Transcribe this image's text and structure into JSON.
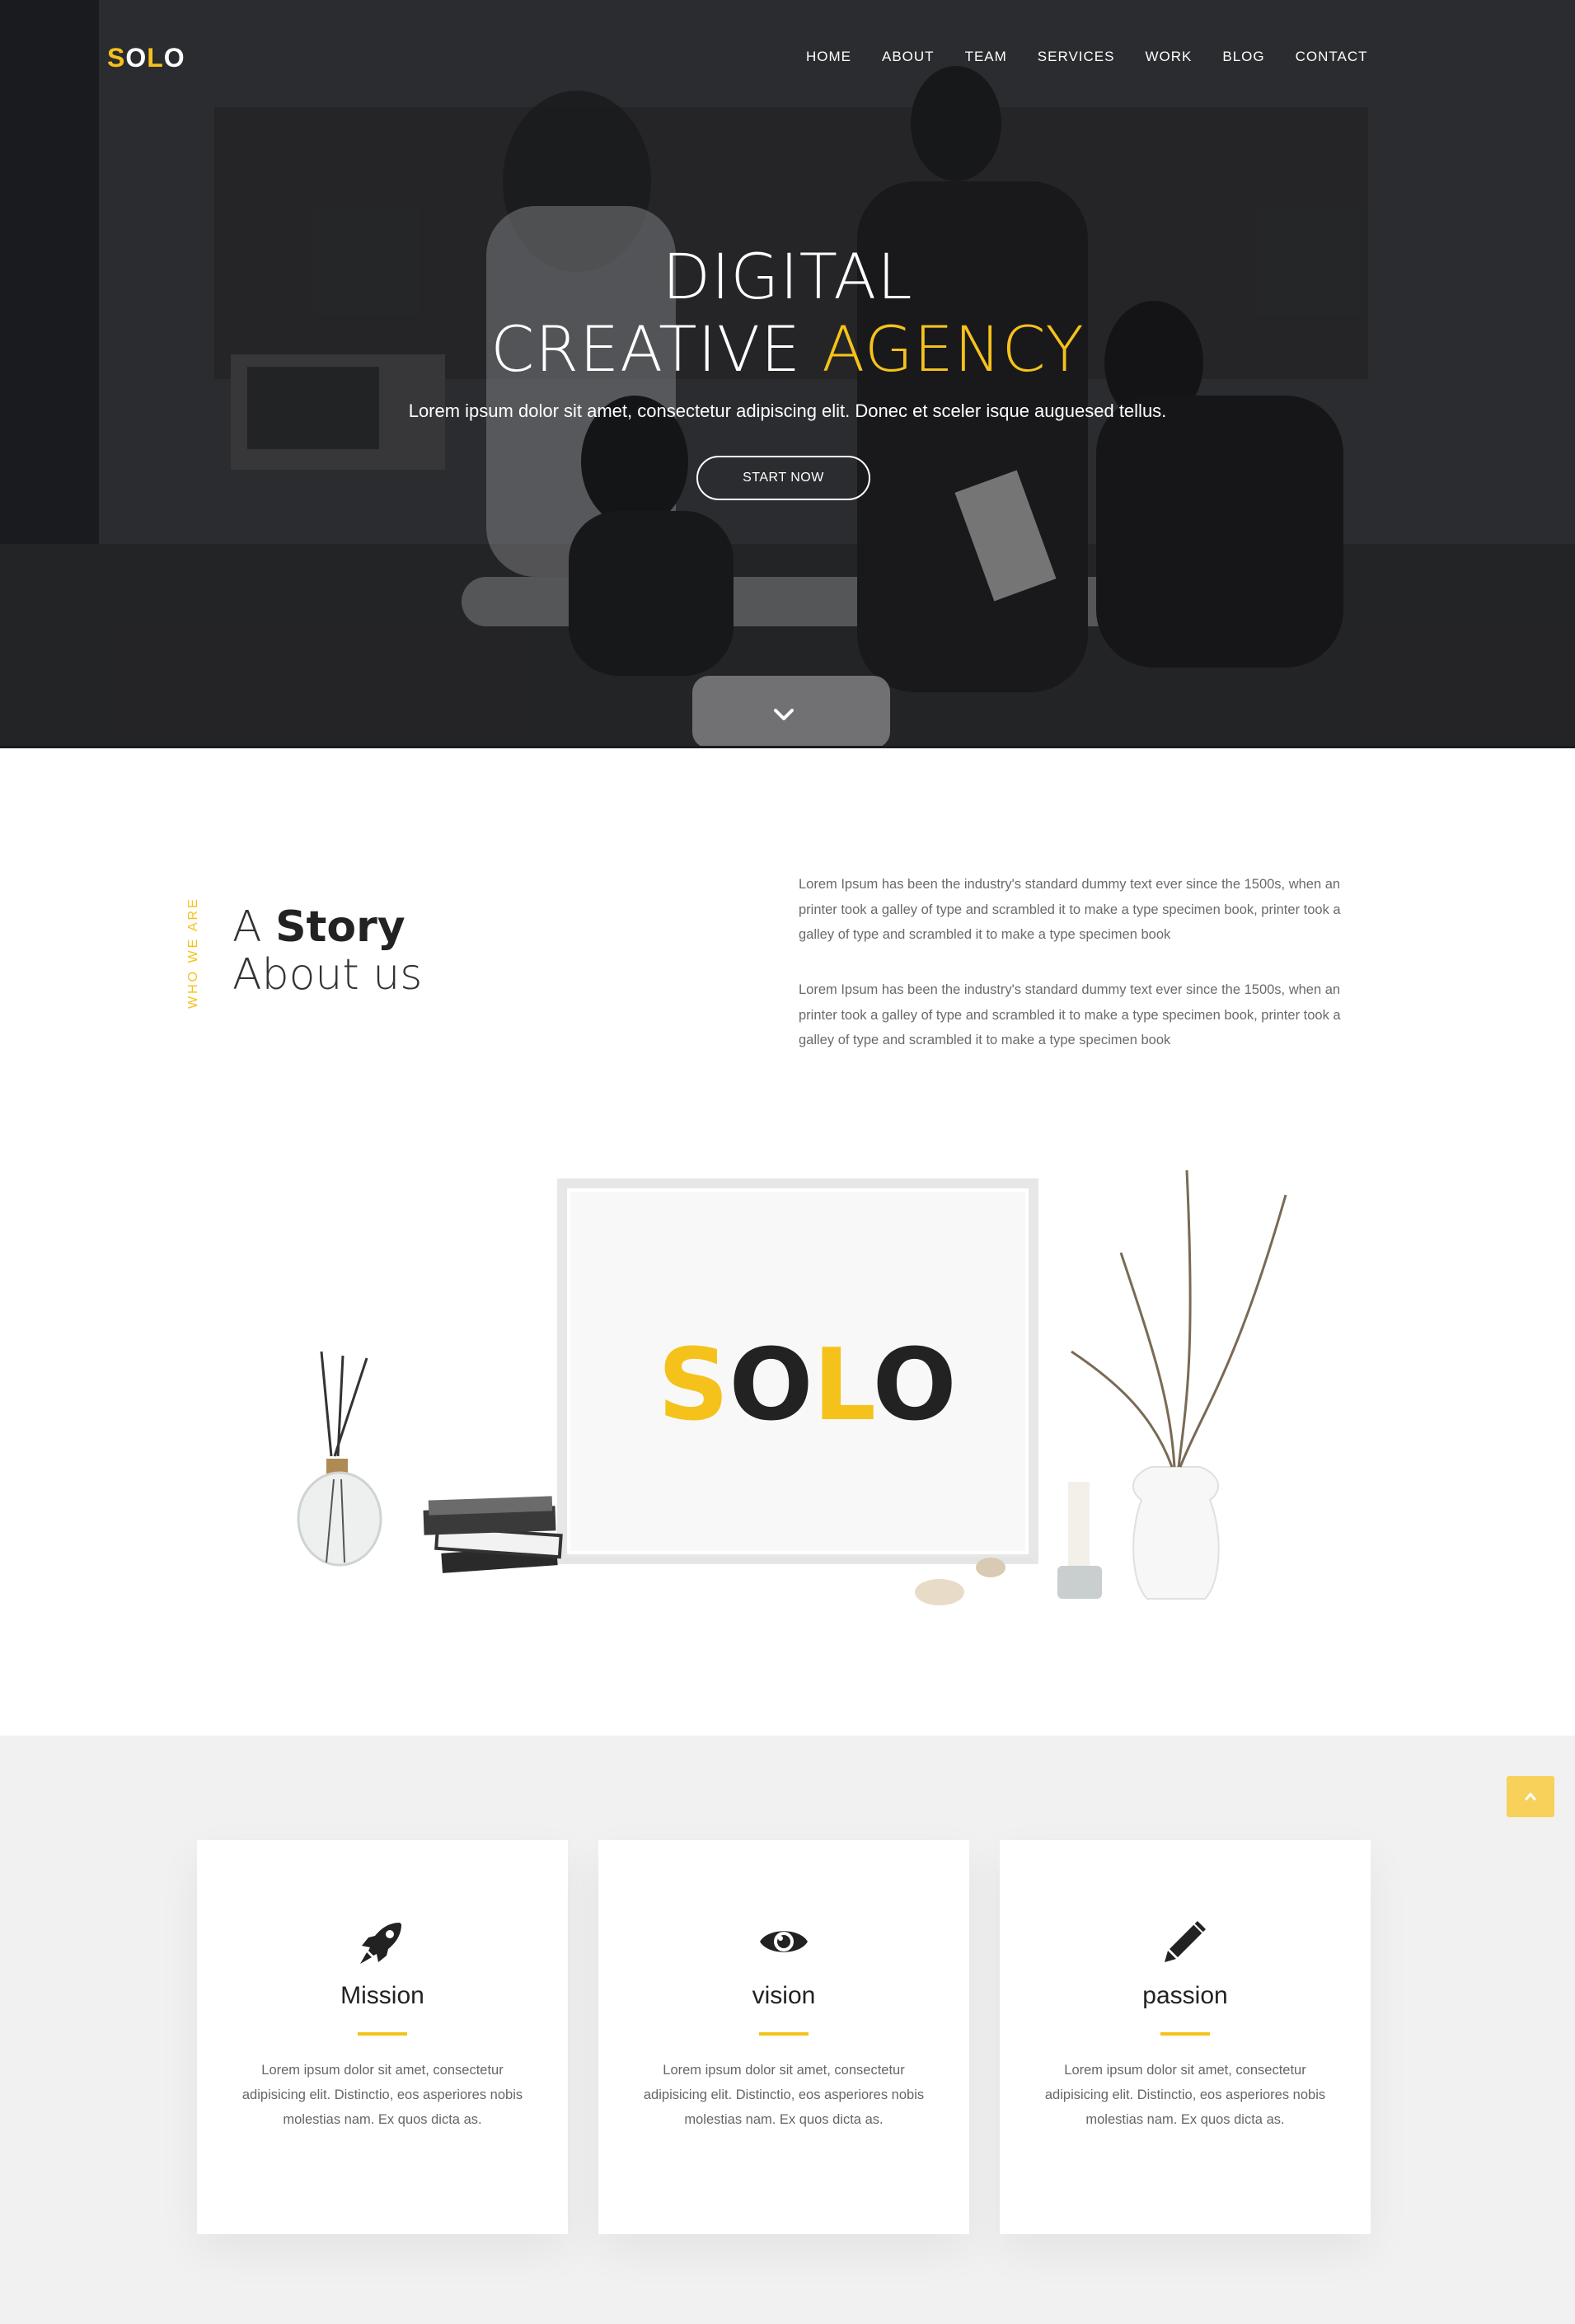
{
  "header": {
    "logo": {
      "letters": [
        "S",
        "O",
        "L",
        "O"
      ],
      "accent_color": "#f5c21b"
    },
    "nav": [
      "HOME",
      "ABOUT",
      "TEAM",
      "SERVICES",
      "WORK",
      "BLOG",
      "CONTACT"
    ]
  },
  "hero": {
    "title_line1": "DIGITAL",
    "title_line2_white": "CREATIVE",
    "title_line2_accent": "AGENCY",
    "subtitle": "Lorem ipsum dolor sit amet, consectetur adipiscing elit. Donec et sceler isque auguesed tellus.",
    "cta": "START NOW",
    "scroll_icon": "chevron-down-icon"
  },
  "story": {
    "vertical_label": "WHO WE ARE",
    "title_light1": "A",
    "title_bold": "Story",
    "title_light2": "About us",
    "paragraphs": [
      "Lorem Ipsum has been the industry's standard dummy text ever since the 1500s, when an printer took a galley of type and scrambled it to make a type specimen book, printer took a galley of type and scrambled it to make a type specimen book",
      "Lorem Ipsum has been the industry's standard dummy text ever since the 1500s, when an printer took a galley of type and scrambled it to make a type specimen book, printer took a galley of type and scrambled it to make a type specimen book"
    ],
    "frame_logo": [
      "S",
      "O",
      "L",
      "O"
    ]
  },
  "features": [
    {
      "icon": "rocket-icon",
      "title": "Mission",
      "text": "Lorem ipsum dolor sit amet, consectetur adipisicing elit. Distinctio, eos asperiores nobis molestias nam. Ex quos dicta as."
    },
    {
      "icon": "eye-icon",
      "title": "vision",
      "text": "Lorem ipsum dolor sit amet, consectetur adipisicing elit. Distinctio, eos asperiores nobis molestias nam. Ex quos dicta as."
    },
    {
      "icon": "pencil-icon",
      "title": "passion",
      "text": "Lorem ipsum dolor sit amet, consectetur adipisicing elit. Distinctio, eos asperiores nobis molestias nam. Ex quos dicta as."
    }
  ],
  "back_to_top_icon": "chevron-up-icon",
  "colors": {
    "accent": "#f5c21b",
    "dark": "#222222",
    "section_bg": "#f1f1f1"
  }
}
